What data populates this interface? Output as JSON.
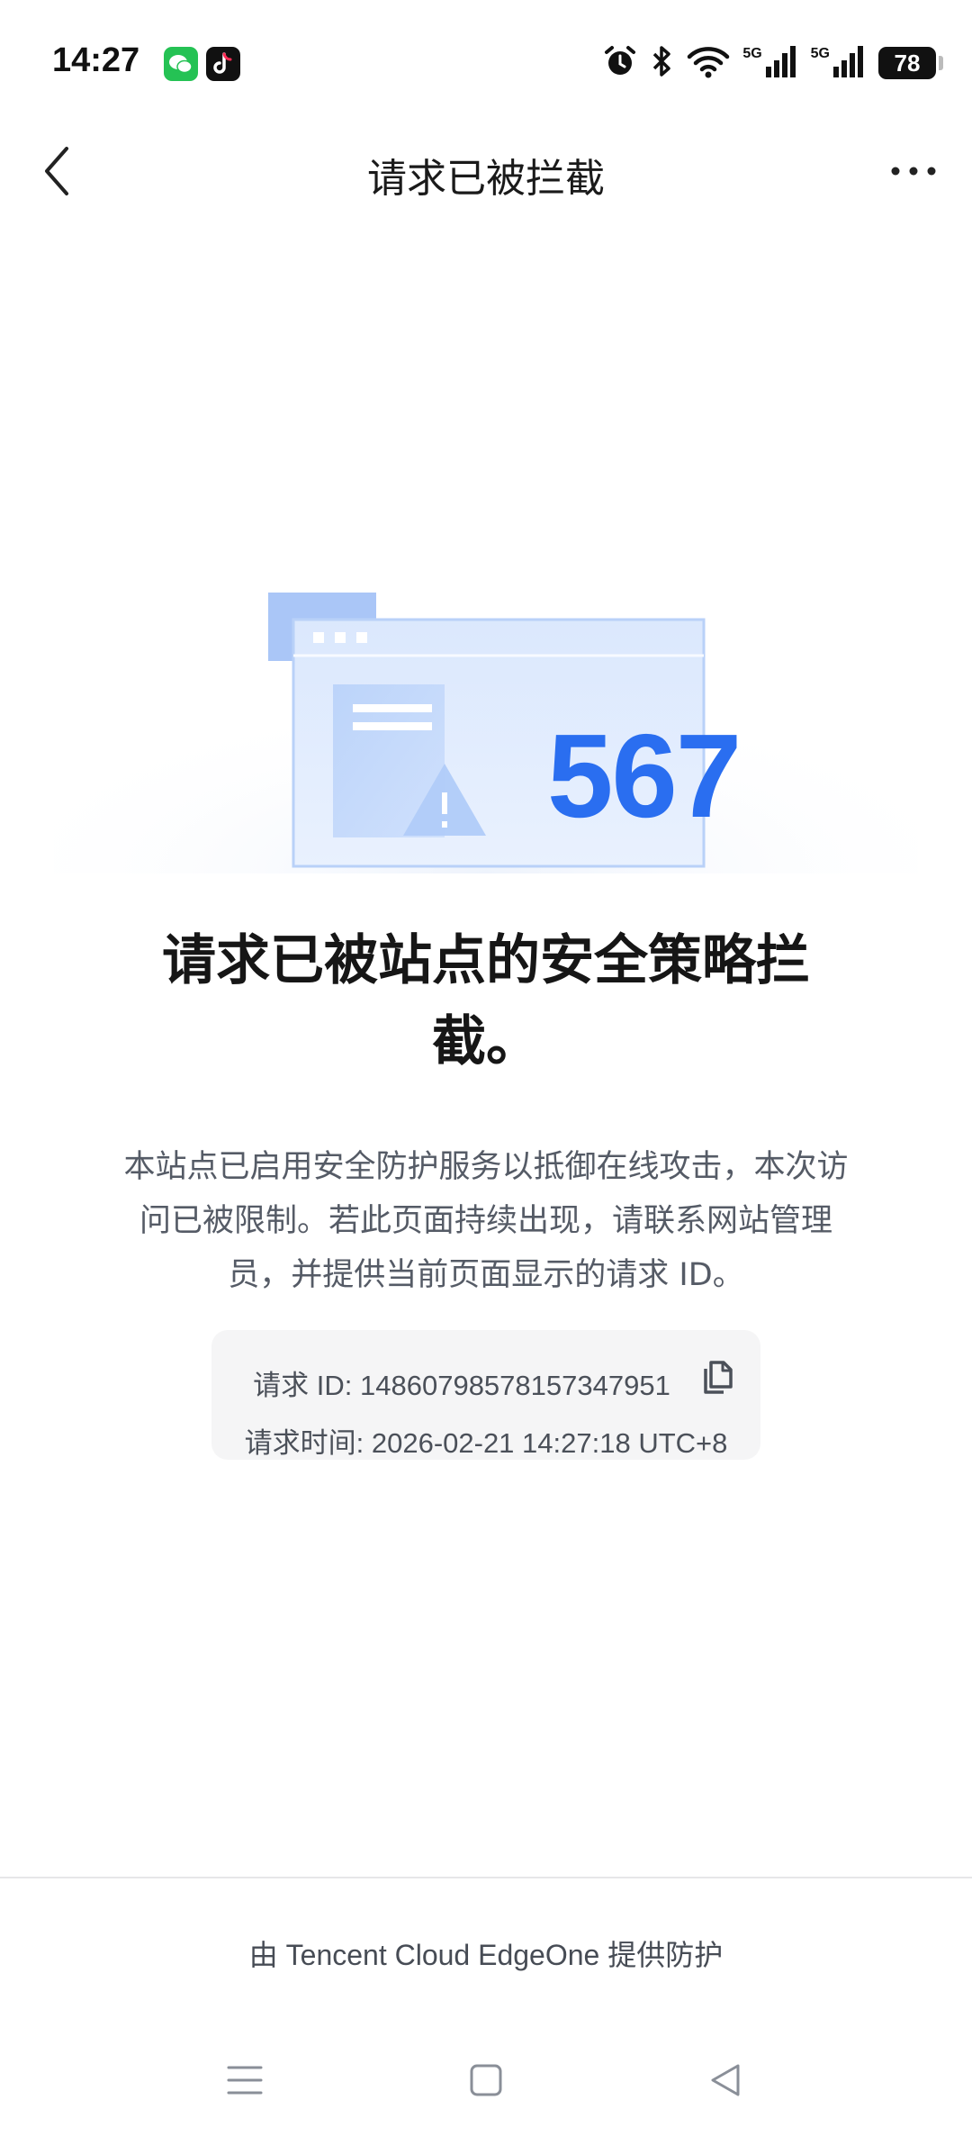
{
  "status_bar": {
    "time": "14:27",
    "signal_label_1": "5G",
    "signal_label_2": "5G",
    "battery": "78",
    "icons": [
      "wechat-icon",
      "tiktok-icon",
      "alarm-icon",
      "bluetooth-icon",
      "wifi-icon",
      "signal-icon",
      "signal-icon",
      "battery-icon"
    ]
  },
  "nav": {
    "title": "请求已被拦截",
    "back_icon": "chevron-left-icon",
    "more_icon": "more-horizontal-icon"
  },
  "illustration": {
    "code": "567"
  },
  "main": {
    "headline_line1": "请求已被站点的安全策略拦",
    "headline_line2": "截。",
    "description_line1": "本站点已启用安全防护服务以抵御在线攻击，本次访",
    "description_line2": "问已被限制。若此页面持续出现，请联系网站管理",
    "description_line3": "员，并提供当前页面显示的请求 ID。"
  },
  "request_info": {
    "id_text": "请求 ID: 14860798578157347951",
    "time_text": "请求时间: 2026-02-21 14:27:18 UTC+8",
    "copy_icon": "copy-icon"
  },
  "footer": {
    "text": "由 Tencent Cloud EdgeOne 提供防护"
  },
  "colors": {
    "accent_blue": "#2a6ef0",
    "illustration_light": "#e3edfd",
    "card_bg": "#f5f5f6",
    "text_primary": "#161616",
    "text_secondary": "#555b66"
  }
}
